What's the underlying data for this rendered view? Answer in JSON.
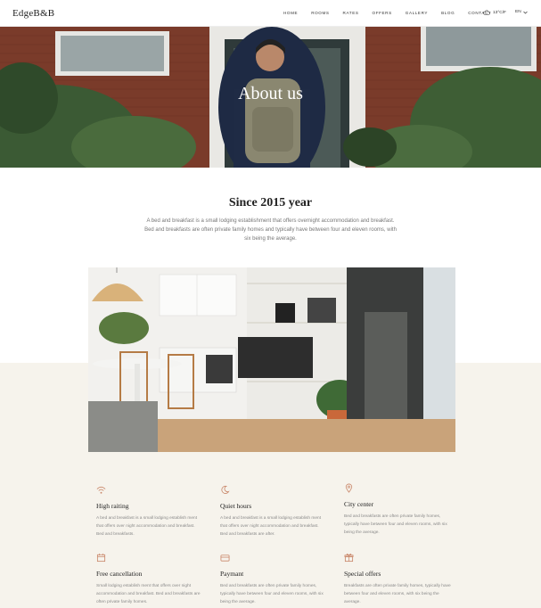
{
  "header": {
    "logo": "EdgeB&B",
    "nav": [
      "HOME",
      "ROOMS",
      "RATES",
      "OFFERS",
      "GALLERY",
      "BLOG",
      "CONTACT"
    ],
    "weather": "13°C/F",
    "language": "EN"
  },
  "hero": {
    "title": "About us"
  },
  "intro": {
    "title": "Since 2015 year",
    "text": "A bed and breakfast is a small lodging establishment that offers overnight accommodation and breakfast. Bed and breakfasts are often private family homes and typically have between four and eleven rooms, with six being the average."
  },
  "video": {
    "play_icon": "play-icon"
  },
  "features": [
    {
      "icon": "wifi-icon",
      "title": "High raiting",
      "text": "A bed and breakfast is a small lodging establish ment that offers over night accommodation and breakfast. Bed and breakfasts."
    },
    {
      "icon": "moon-icon",
      "title": "Quiet hours",
      "text": "A bed and breakfast is a small lodging establish ment that offers over night accommodation and breakfast. Bed and breakfasts are after."
    },
    {
      "icon": "location-pin-icon",
      "title": "City center",
      "text": "Bed and breakfasts are often private family homes, typically have between four and eleven rooms, with six being the average."
    },
    {
      "icon": "calendar-icon",
      "title": "Free cancellation",
      "text": "Small lodging establish ment that offers over night accommodation and breakfast. Bed and breakfasts are often private family homes."
    },
    {
      "icon": "credit-card-icon",
      "title": "Paymant",
      "text": "Bed and breakfasts are often private family homes, typically have between four and eleven rooms, with six being the average."
    },
    {
      "icon": "gift-icon",
      "title": "Special offers",
      "text": "Breakfasts are often private family homes, typically have between four and eleven rooms, with six being the average."
    }
  ],
  "colors": {
    "accent": "#c9876a",
    "beige": "#f6f3ec"
  }
}
